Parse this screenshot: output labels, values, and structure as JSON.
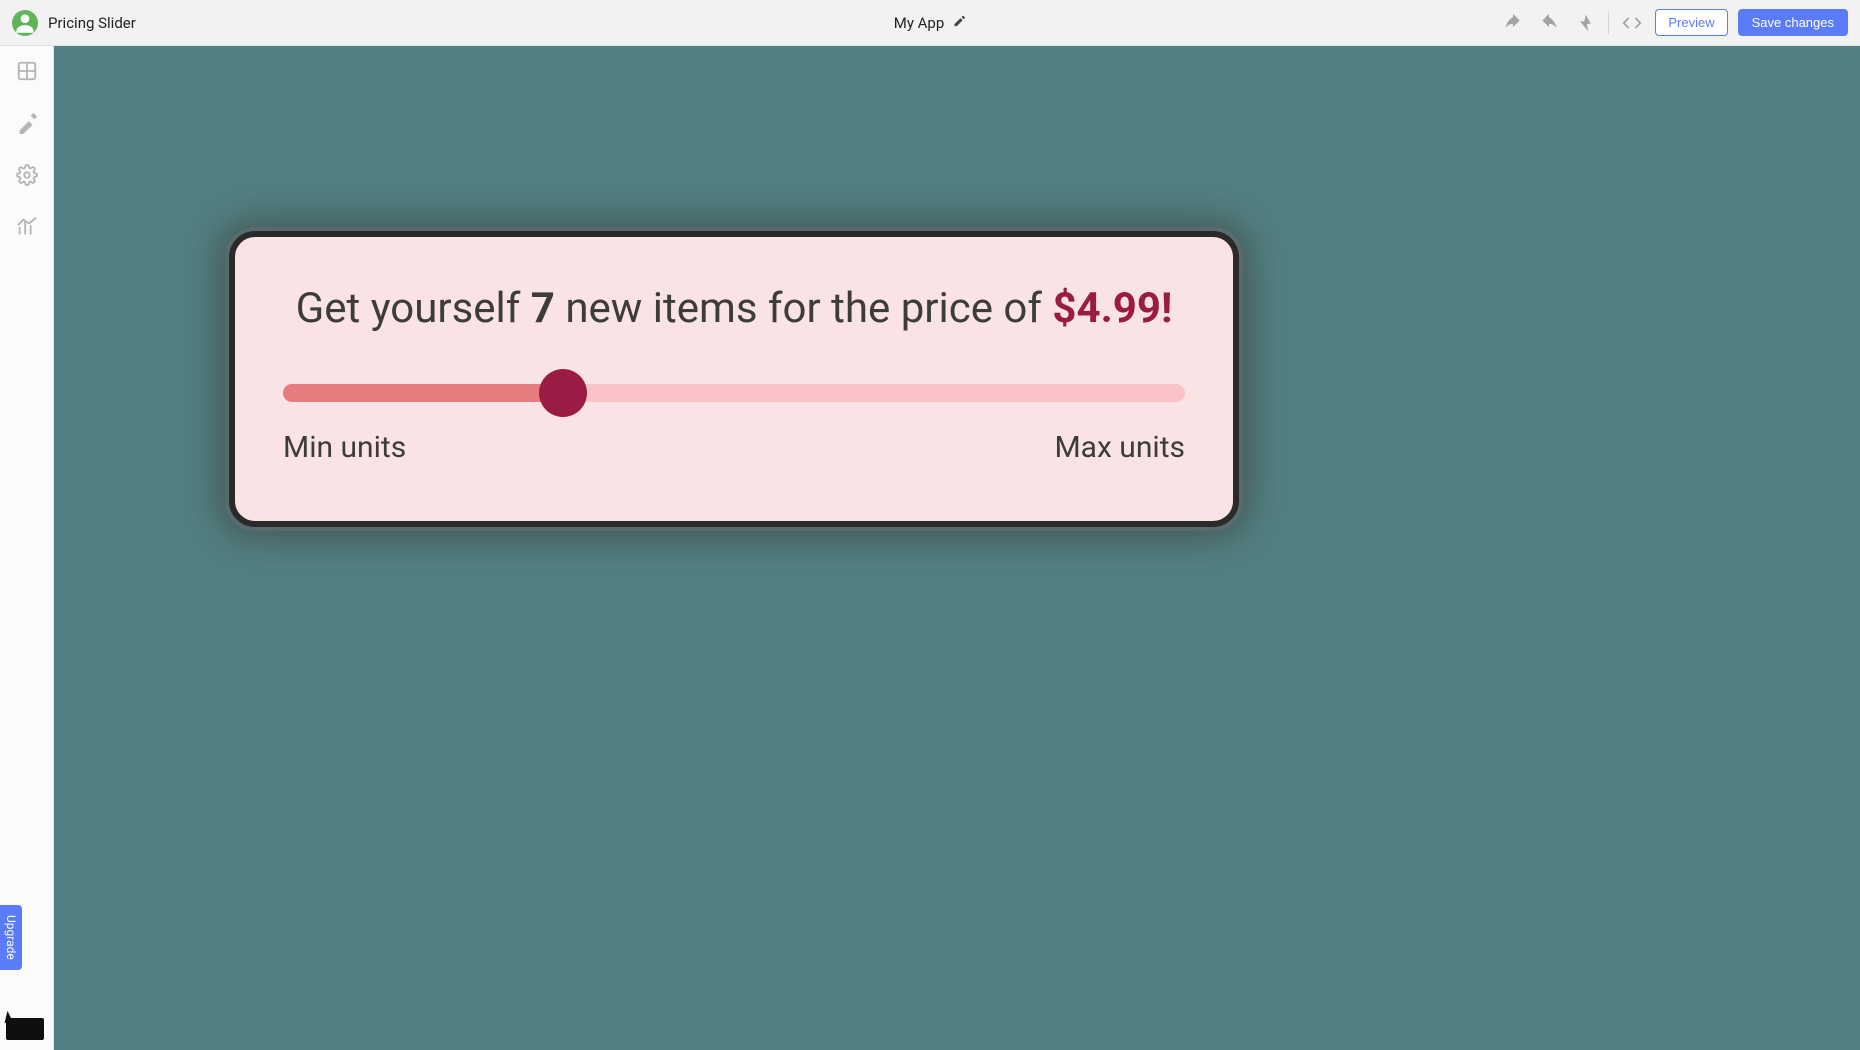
{
  "header": {
    "project_name": "Pricing Slider",
    "app_name": "My App",
    "preview_label": "Preview",
    "save_label": "Save changes"
  },
  "sidebar": {
    "upgrade_label": "Upgrade"
  },
  "card": {
    "text_before_qty": "Get yourself ",
    "quantity": "7",
    "text_after_qty": " new items for the price of ",
    "price": "$4.99!",
    "min_label": "Min units",
    "max_label": "Max units",
    "slider_percent": 31
  }
}
